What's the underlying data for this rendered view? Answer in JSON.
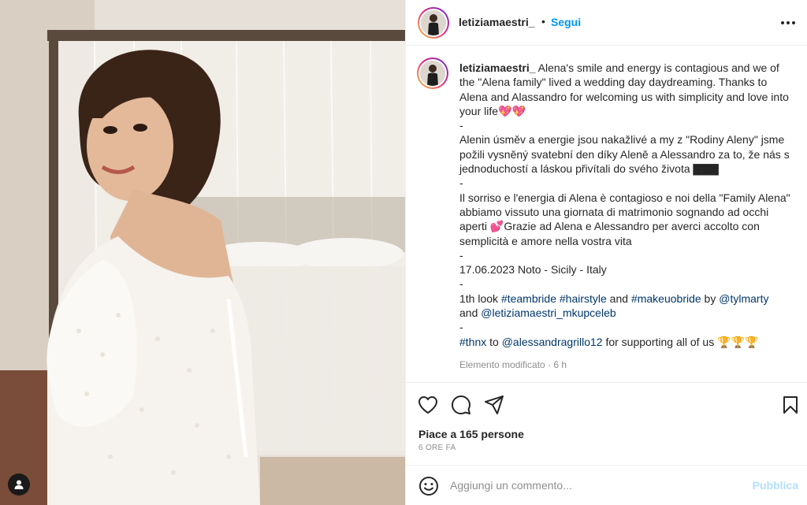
{
  "post": {
    "username": "letiziamaestri_",
    "follow_label": "Segui",
    "header_separator": "•",
    "more_icon": "more-horizontal-icon"
  },
  "caption": {
    "username": "letiziamaestri_",
    "text": " Alena's smile and energy is contagious and we of the \"Alena family\" lived a wedding day daydreaming. Thanks to Alena and Alassandro for welcoming us with simplicity and love into your life💖💖\n-\nAlenin úsměv a energie jsou nakažlivé a my z \"Rodiny Aleny\" jsme požili vysněný svatební den díky Aleně a Alessandro za to, že nás s jednoduchostí a láskou přivítali do svého života ▇▇▇\n-\nIl sorriso e l'energia di Alena è contagioso e noi della \"Family Alena\" abbiamo vissuto una giornata di matrimonio sognando ad occhi aperti 💕Grazie ad Alena e Alessandro per averci accolto con semplicità e amore nella vostra vita\n-\n17.06.2023 Noto - Sicily - Italy\n-\n",
    "line_look_prefix": "1th look ",
    "hashtag_teambride": "#teambride",
    "hashtag_hairstyle": "#hairstyle",
    "and_1": " and ",
    "hashtag_makeuobride": "#makeuobride",
    "by": " by ",
    "mention_tylmarty": "@tylmarty",
    "and_2": "\nand ",
    "mention_mkupceleb": "@letiziamaestri_mkupceleb",
    "dash": "\n-\n",
    "hashtag_thnx": "#thnx",
    "to": " to ",
    "mention_alessandragrillo": "@alessandragrillo12",
    "supporting": " for supporting all of us 🏆🏆🏆"
  },
  "edited": {
    "label": "Elemento modificato",
    "separator": " · ",
    "time": "6 h"
  },
  "engagement": {
    "likes_label": "Piace a 165 persone",
    "timestamp": "6 ORE FA"
  },
  "comment_box": {
    "placeholder": "Aggiungi un commento...",
    "post_label": "Pubblica"
  },
  "colors": {
    "link": "#00376b",
    "follow": "#0095f6",
    "secondary": "#8e8e8e",
    "post_disabled": "#b2dffc"
  },
  "icons": [
    "heart-icon",
    "comment-icon",
    "share-icon",
    "bookmark-icon",
    "emoji-icon",
    "user-tag-icon",
    "more-horizontal-icon"
  ]
}
